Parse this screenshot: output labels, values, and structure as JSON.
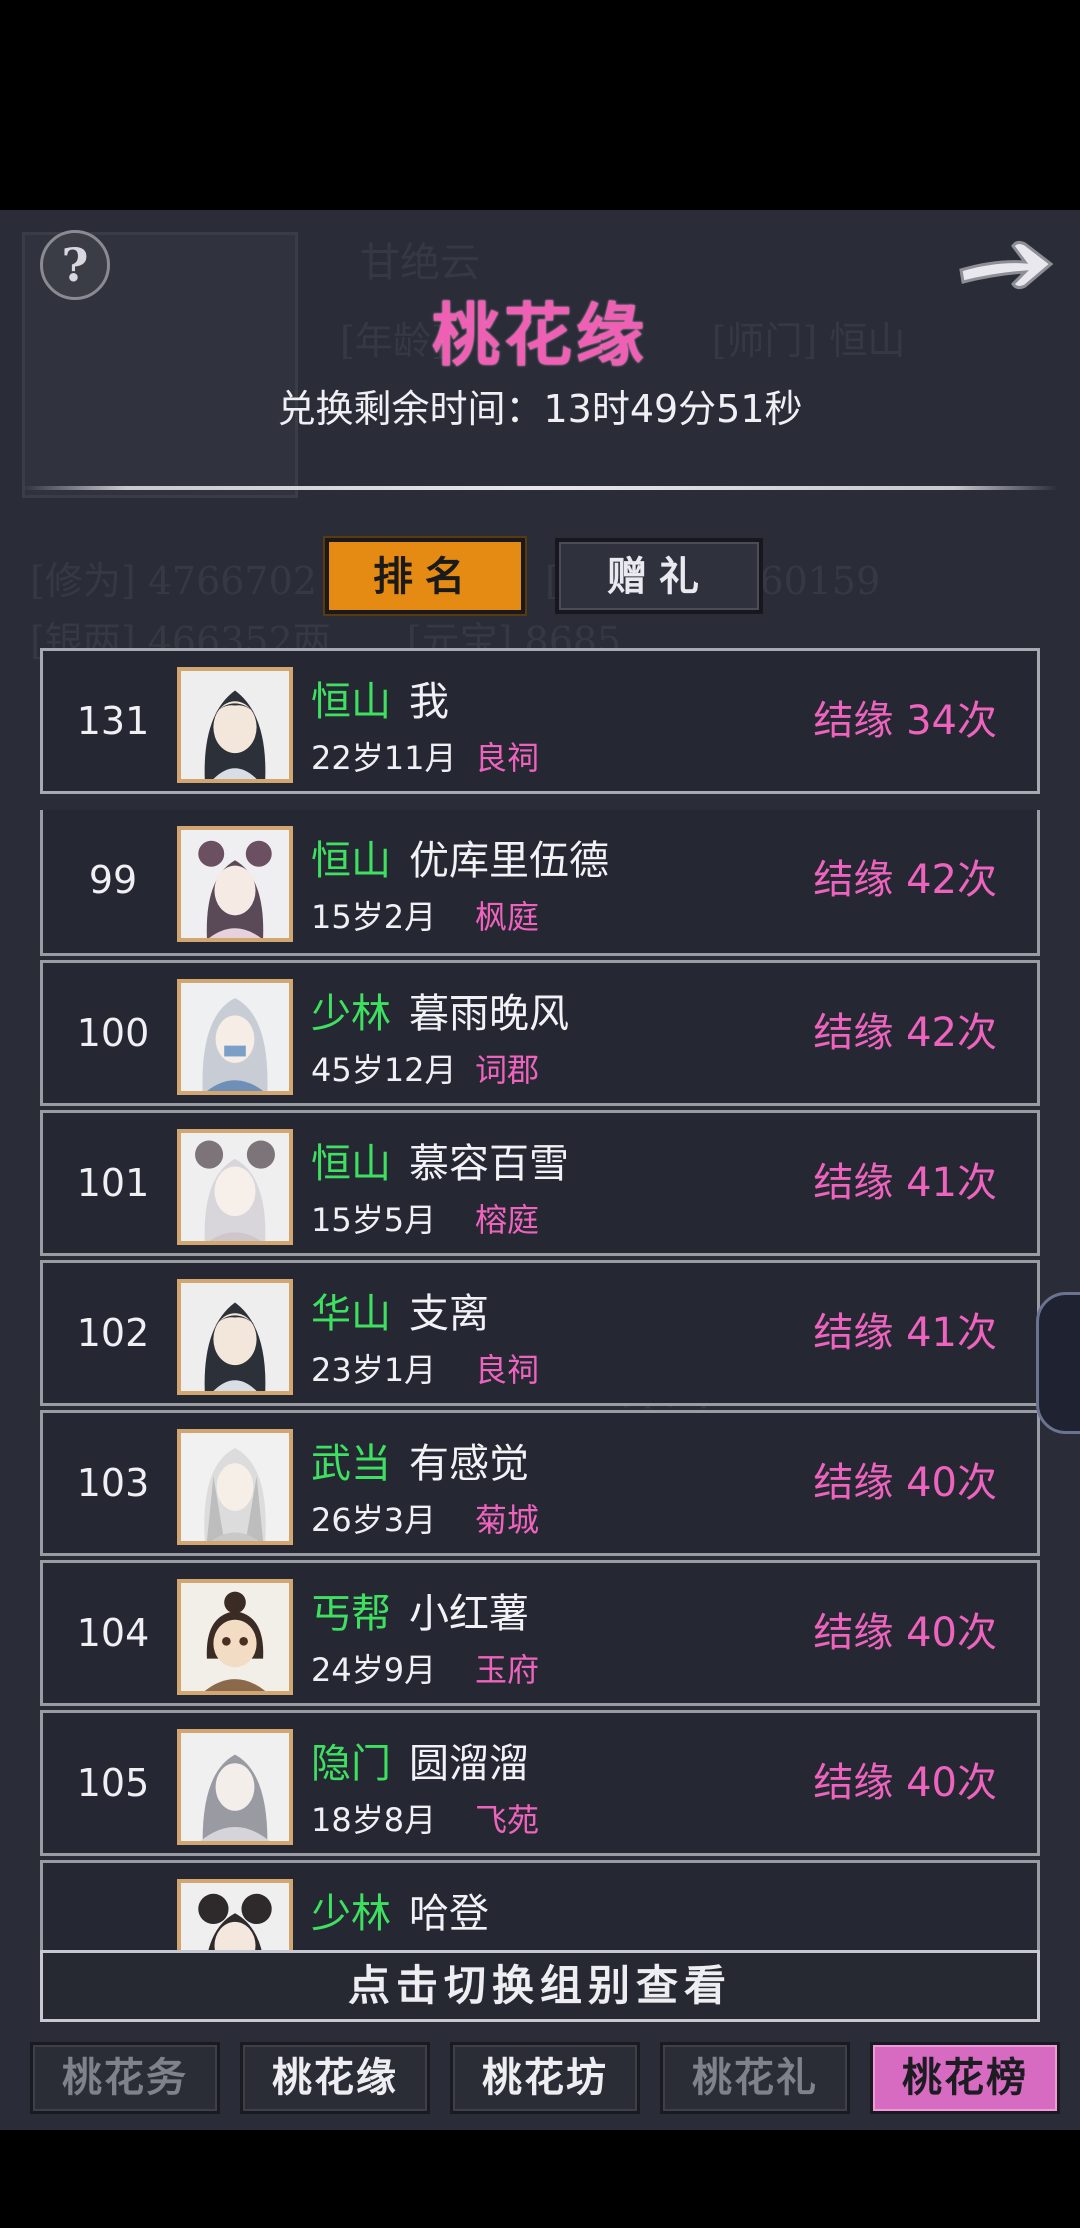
{
  "header": {
    "help_icon": "question-mark-icon",
    "back_icon": "arrow-right-icon",
    "title": "桃花缘",
    "timer_text": "兑换剩余时间：13时49分51秒"
  },
  "tabs": {
    "rank_label": "排名",
    "gift_label": "赠礼",
    "active": "rank"
  },
  "my_entry": {
    "rank": "131",
    "sect": "恒山",
    "name": "我",
    "age": "22岁11月",
    "place": "良祠",
    "count": "结缘 34次"
  },
  "ranking_list": [
    {
      "rank": "99",
      "sect": "恒山",
      "name": "优库里伍德",
      "age": "15岁2月",
      "place": "枫庭",
      "count": "结缘 42次"
    },
    {
      "rank": "100",
      "sect": "少林",
      "name": "暮雨晚风",
      "age": "45岁12月",
      "place": "词郡",
      "count": "结缘 42次"
    },
    {
      "rank": "101",
      "sect": "恒山",
      "name": "慕容百雪",
      "age": "15岁5月",
      "place": "榕庭",
      "count": "结缘 41次"
    },
    {
      "rank": "102",
      "sect": "华山",
      "name": "支离",
      "age": "23岁1月",
      "place": "良祠",
      "count": "结缘 41次"
    },
    {
      "rank": "103",
      "sect": "武当",
      "name": "有感觉",
      "age": "26岁3月",
      "place": "菊城",
      "count": "结缘 40次"
    },
    {
      "rank": "104",
      "sect": "丐帮",
      "name": "小红薯",
      "age": "24岁9月",
      "place": "玉府",
      "count": "结缘 40次"
    },
    {
      "rank": "105",
      "sect": "隐门",
      "name": "圆溜溜",
      "age": "18岁8月",
      "place": "飞苑",
      "count": "结缘 40次"
    },
    {
      "rank": "",
      "sect": "少林",
      "name": "哈登",
      "age": "",
      "place": "",
      "count": ""
    }
  ],
  "switch_button": "点击切换组别查看",
  "bottom_nav": [
    {
      "label": "桃花务",
      "state": "dim"
    },
    {
      "label": "桃花缘",
      "state": "bright"
    },
    {
      "label": "桃花坊",
      "state": "bright"
    },
    {
      "label": "桃花礼",
      "state": "dim"
    },
    {
      "label": "桃花榜",
      "state": "active"
    }
  ],
  "colors": {
    "title_pink": "#ef5fb4",
    "sect_green": "#3ee060",
    "count_pink": "#ee63be",
    "active_tab_orange": "#e58a12",
    "active_nav_pink": "#d76bc1",
    "panel_bg": "#2a2d38"
  }
}
